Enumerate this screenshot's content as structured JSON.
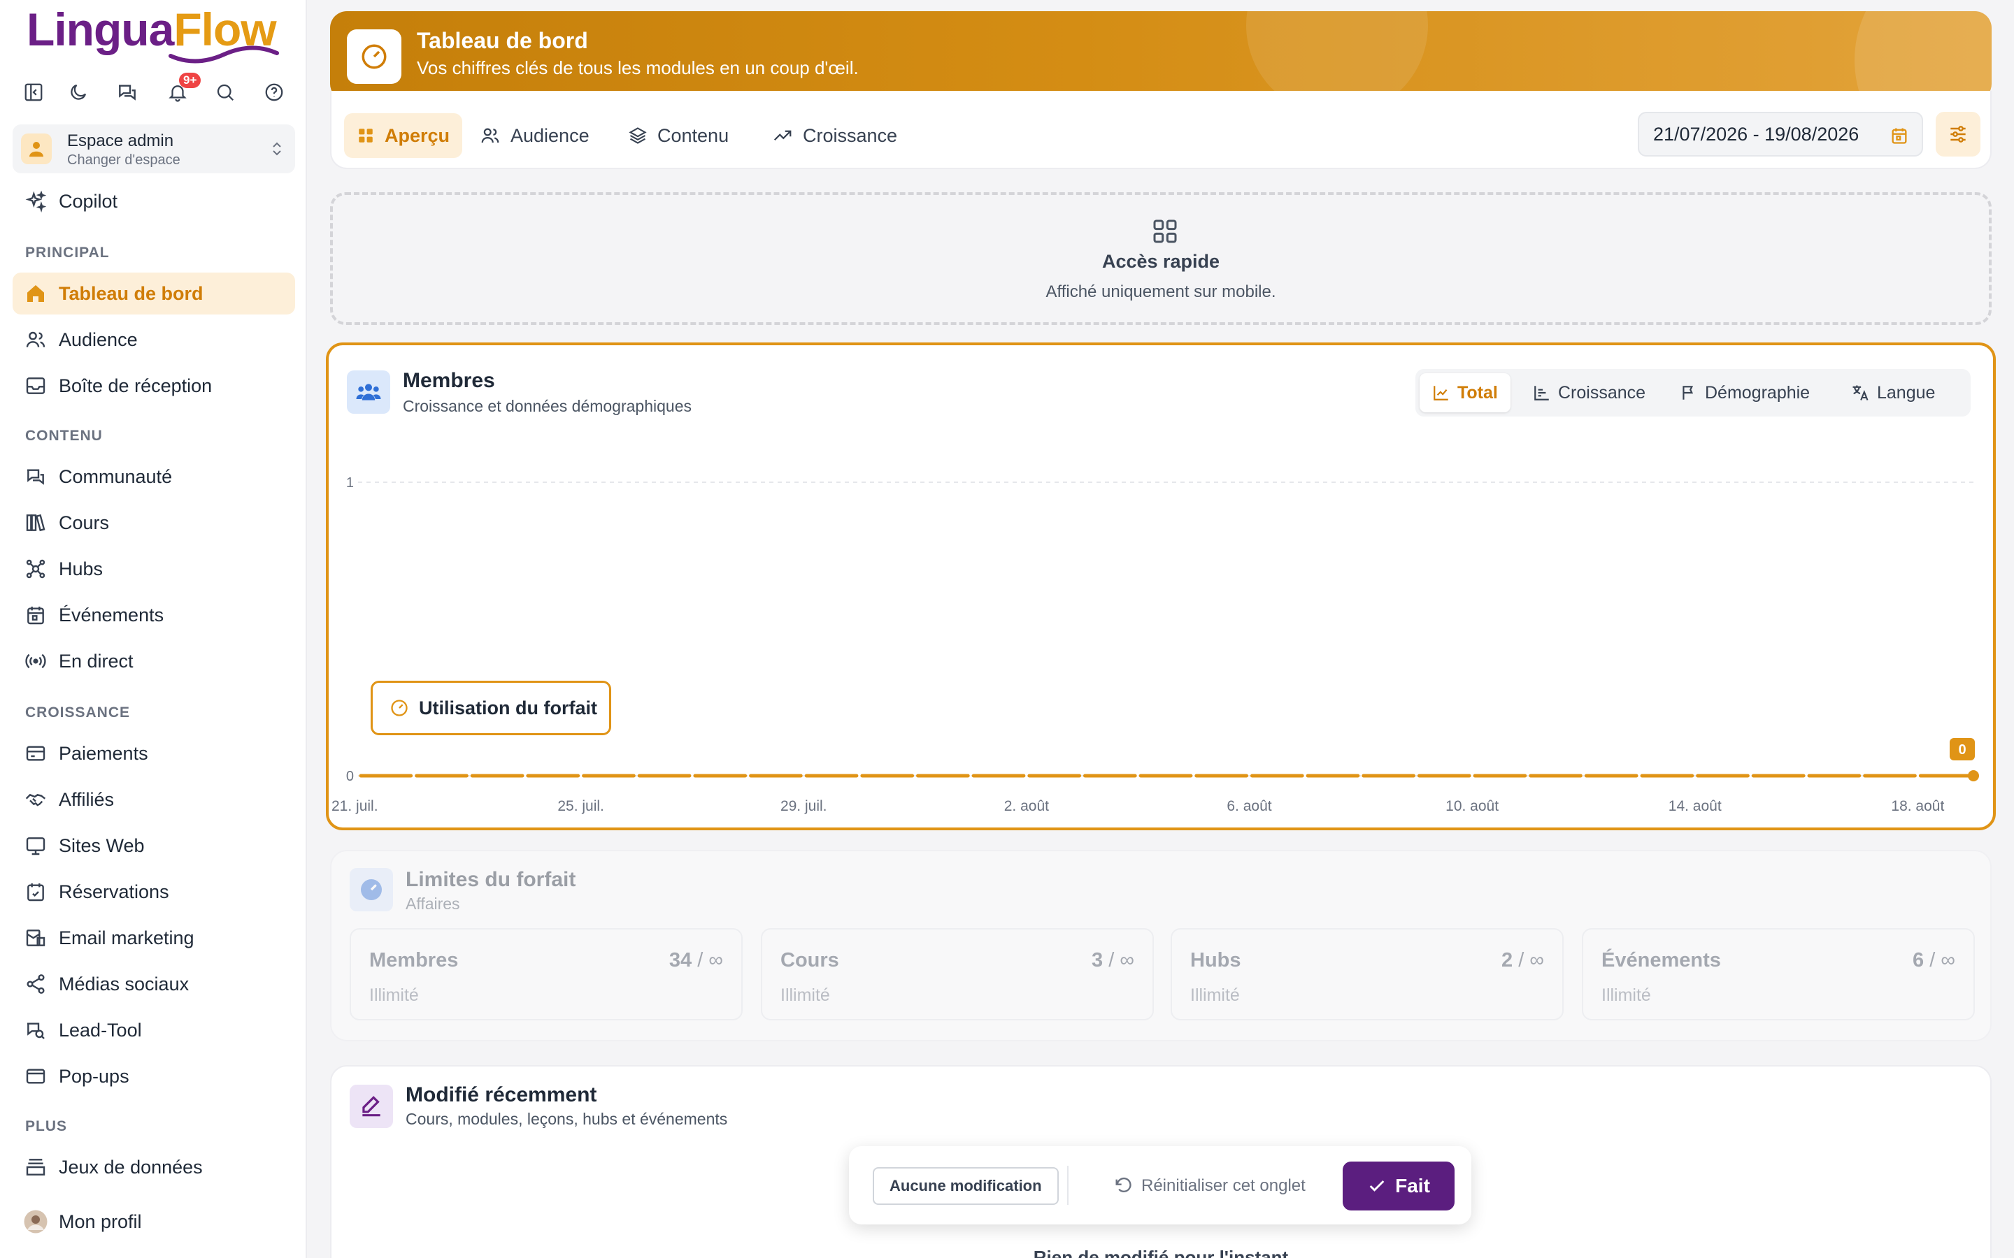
{
  "app": {
    "brand_part1": "Lingua",
    "brand_part2": "Flow",
    "notif_badge": "9+"
  },
  "workspace": {
    "title": "Espace admin",
    "subtitle": "Changer d'espace"
  },
  "nav": {
    "copilot": "Copilot",
    "sections": {
      "principal": "PRINCIPAL",
      "contenu": "CONTENU",
      "croissance": "CROISSANCE",
      "plus": "PLUS"
    },
    "items": {
      "dashboard": "Tableau de bord",
      "audience": "Audience",
      "inbox": "Boîte de réception",
      "community": "Communauté",
      "courses": "Cours",
      "hubs": "Hubs",
      "events": "Événements",
      "live": "En direct",
      "payments": "Paiements",
      "affiliates": "Affiliés",
      "websites": "Sites Web",
      "bookings": "Réservations",
      "email": "Email marketing",
      "social": "Médias sociaux",
      "leadtool": "Lead-Tool",
      "popups": "Pop-ups",
      "datasets": "Jeux de données",
      "profile": "Mon profil"
    }
  },
  "header": {
    "title": "Tableau de bord",
    "subtitle": "Vos chiffres clés de tous les modules en un coup d'œil."
  },
  "tabs": {
    "overview": "Aperçu",
    "audience": "Audience",
    "content": "Contenu",
    "growth": "Croissance"
  },
  "daterange": "21/07/2026 - 19/08/2026",
  "quick_access": {
    "title": "Accès rapide",
    "subtitle": "Affiché uniquement sur mobile."
  },
  "members": {
    "title": "Membres",
    "subtitle": "Croissance et données démographiques",
    "segments": {
      "total": "Total",
      "growth": "Croissance",
      "demographics": "Démographie",
      "language": "Langue"
    },
    "plan_usage_button": "Utilisation du forfait",
    "last_value_label": "0"
  },
  "chart_data": {
    "type": "line",
    "x": [
      "21/07",
      "22/07",
      "23/07",
      "24/07",
      "25/07",
      "26/07",
      "27/07",
      "28/07",
      "29/07",
      "30/07",
      "31/07",
      "01/08",
      "02/08",
      "03/08",
      "04/08",
      "05/08",
      "06/08",
      "07/08",
      "08/08",
      "09/08",
      "10/08",
      "11/08",
      "12/08",
      "13/08",
      "14/08",
      "15/08",
      "16/08",
      "17/08",
      "18/08",
      "19/08"
    ],
    "series": [
      {
        "values": [
          0,
          0,
          0,
          0,
          0,
          0,
          0,
          0,
          0,
          0,
          0,
          0,
          0,
          0,
          0,
          0,
          0,
          0,
          0,
          0,
          0,
          0,
          0,
          0,
          0,
          0,
          0,
          0,
          0,
          0
        ]
      }
    ],
    "xticks": [
      "21. juil.",
      "25. juil.",
      "29. juil.",
      "2. août",
      "6. août",
      "10. août",
      "14. août",
      "18. août"
    ],
    "yticks": [
      "0",
      "1"
    ],
    "ylim": [
      0,
      1
    ],
    "grid": true,
    "color": "#e09416"
  },
  "limits": {
    "title": "Limites du forfait",
    "subtitle": "Affaires",
    "items": [
      {
        "name": "Membres",
        "value": "34",
        "sep": "/ ∞",
        "sub": "Illimité"
      },
      {
        "name": "Cours",
        "value": "3",
        "sep": "/ ∞",
        "sub": "Illimité"
      },
      {
        "name": "Hubs",
        "value": "2",
        "sep": "/ ∞",
        "sub": "Illimité"
      },
      {
        "name": "Événements",
        "value": "6",
        "sep": "/ ∞",
        "sub": "Illimité"
      }
    ]
  },
  "recent": {
    "title": "Modifié récemment",
    "subtitle": "Cours, modules, leçons, hubs et événements",
    "empty": "Rien de modifié pour l'instant"
  },
  "toast": {
    "no_changes": "Aucune modification",
    "reset": "Réinitialiser cet onglet",
    "done": "Fait"
  },
  "colors": {
    "accent": "#e09416",
    "brand_purple": "#5b1e7f",
    "active_bg": "#fdefd9"
  }
}
